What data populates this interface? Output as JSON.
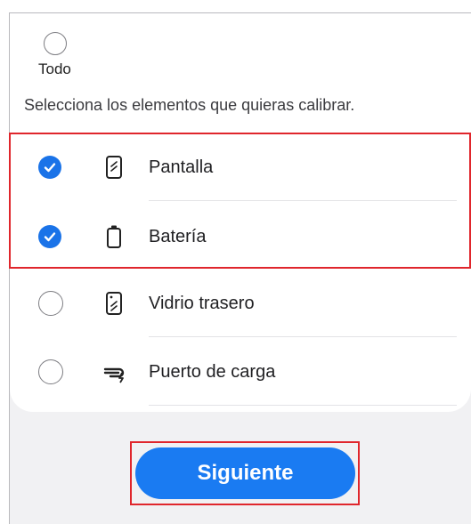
{
  "todo": {
    "label": "Todo",
    "selected": false
  },
  "instruction": "Selecciona los elementos que quieras calibrar.",
  "items": [
    {
      "label": "Pantalla",
      "icon": "phone-screen-icon",
      "checked": true
    },
    {
      "label": "Batería",
      "icon": "battery-icon",
      "checked": true
    },
    {
      "label": "Vidrio trasero",
      "icon": "phone-back-glass-icon",
      "checked": false
    },
    {
      "label": "Puerto de carga",
      "icon": "charging-cable-icon",
      "checked": false
    }
  ],
  "next_button": {
    "label": "Siguiente"
  },
  "colors": {
    "accent": "#1a73e8",
    "button": "#1a7bf2",
    "highlight": "#e0262c"
  }
}
